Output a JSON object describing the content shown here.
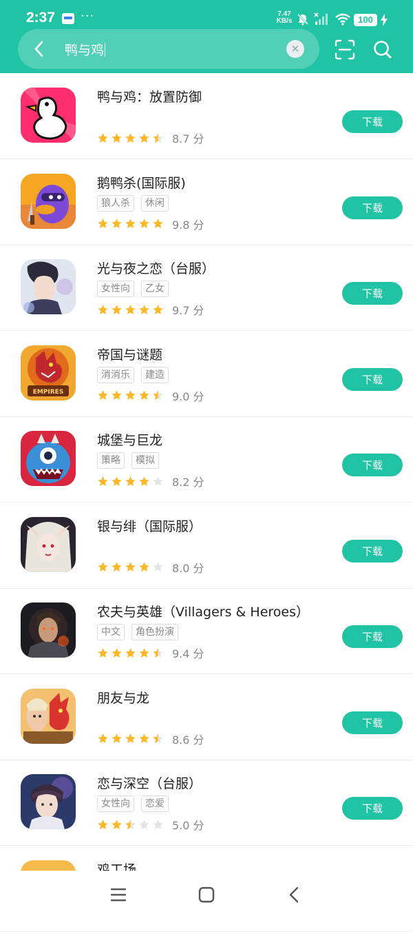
{
  "status_bar": {
    "time": "2:37",
    "more": "···",
    "speed_value": "7.47",
    "speed_unit": "KB/s",
    "battery": "100"
  },
  "search": {
    "query": "鸭与鸡"
  },
  "download_label": "下载",
  "accent_color": "#20c3a3",
  "apps": [
    {
      "name": "鸭与鸡：放置防御",
      "tags": [],
      "rating": 4.5,
      "score": "8.7 分",
      "icon": "duck-chicken-icon"
    },
    {
      "name": "鹅鸭杀(国际服)",
      "tags": [
        "狼人杀",
        "休闲"
      ],
      "rating": 5,
      "score": "9.8 分",
      "icon": "goose-duck-icon"
    },
    {
      "name": "光与夜之恋（台服）",
      "tags": [
        "女性向",
        "乙女"
      ],
      "rating": 5,
      "score": "9.7 分",
      "icon": "light-night-icon"
    },
    {
      "name": "帝国与谜题",
      "tags": [
        "消消乐",
        "建造"
      ],
      "rating": 4.5,
      "score": "9.0 分",
      "icon": "empires-puzzles-icon"
    },
    {
      "name": "城堡与巨龙",
      "tags": [
        "策略",
        "模拟"
      ],
      "rating": 4,
      "score": "8.2 分",
      "icon": "castle-dragon-icon"
    },
    {
      "name": "银与绯（国际服）",
      "tags": [],
      "rating": 4,
      "score": "8.0 分",
      "icon": "silver-scarlet-icon"
    },
    {
      "name": "农夫与英雄（Villagers & Heroes）",
      "tags": [
        "中文",
        "角色扮演"
      ],
      "rating": 4.5,
      "score": "9.4 分",
      "icon": "villagers-heroes-icon"
    },
    {
      "name": "朋友与龙",
      "tags": [],
      "rating": 4.5,
      "score": "8.6 分",
      "icon": "friends-dragon-icon"
    },
    {
      "name": "恋与深空（台服）",
      "tags": [
        "女性向",
        "恋爱"
      ],
      "rating": 2.5,
      "score": "5.0 分",
      "icon": "love-deepspace-icon"
    },
    {
      "name": "鸡工场",
      "tags": [],
      "rating": 0,
      "score": "",
      "icon": "chicken-factory-icon"
    }
  ]
}
